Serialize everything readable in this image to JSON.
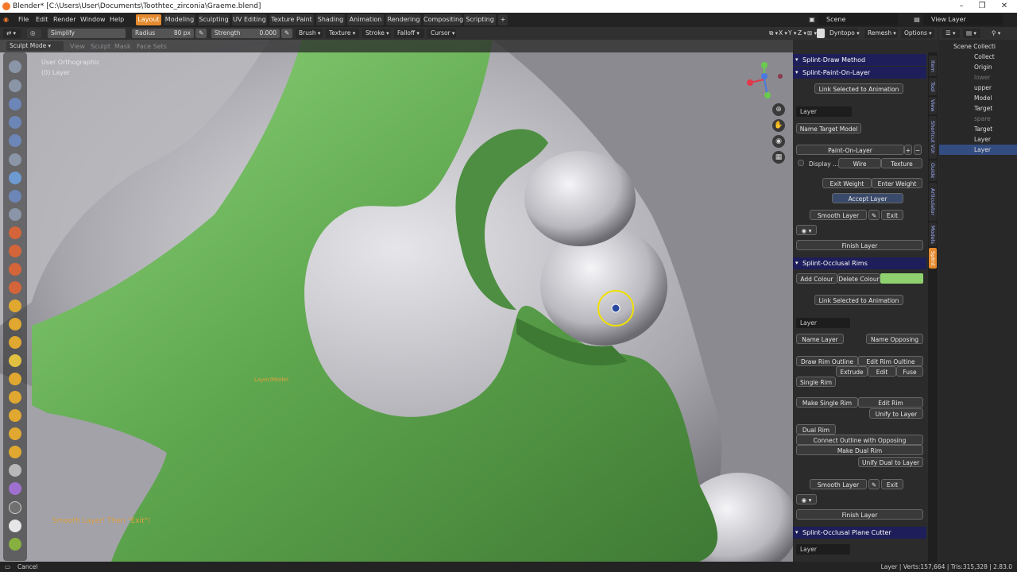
{
  "window": {
    "title": "Blender* [C:\\Users\\User\\Documents\\Toothtec_zirconia\\Graeme.blend]",
    "controls": [
      "–",
      "❐",
      "✕"
    ]
  },
  "menubar": {
    "menus": [
      "File",
      "Edit",
      "Render",
      "Window",
      "Help"
    ],
    "workspaces": [
      "Layout",
      "Modeling",
      "Sculpting",
      "UV Editing",
      "Texture Paint",
      "Shading",
      "Animation",
      "Rendering",
      "Compositing",
      "Scripting"
    ],
    "active_workspace": "Layout",
    "scene": "Scene",
    "view_layer": "View Layer"
  },
  "toolheader": {
    "brush_name": "Simplify",
    "radius_label": "Radius",
    "radius_value": "80 px",
    "strength_label": "Strength",
    "strength_value": "0.000",
    "dropdowns": [
      "Brush",
      "Texture",
      "Stroke",
      "Falloff",
      "Cursor"
    ],
    "axes": [
      "X",
      "Y",
      "Z"
    ],
    "dyntopo": "Dyntopo",
    "remesh": "Remesh",
    "options": "Options"
  },
  "viewport": {
    "mode": "Sculpt Mode",
    "menus": [
      "View",
      "Sculpt",
      "Mask",
      "Face Sets"
    ],
    "view_name": "User Orthographic",
    "layer_info": "(0) Layer",
    "object_label": "Layer/Model",
    "hint_text": "Smooth Layer! Then \"Exit\"!"
  },
  "npanel": {
    "draw_method": "Splint-Draw Method",
    "paint_on_layer": {
      "title": "Splint-Paint-On-Layer",
      "link_button": "Link Selected to Animation",
      "layer_field": "Layer",
      "name_target": "Name Target Model",
      "paint_on_layer": "Paint-On-Layer",
      "display_label": "Display ...",
      "wire": "Wire",
      "texture": "Texture",
      "exit_weight": "Exit Weight",
      "enter_weight": "Enter Weight",
      "accept_layer": "Accept Layer",
      "smooth_layer": "Smooth Layer",
      "exit": "Exit",
      "finish_layer": "Finish Layer"
    },
    "occlusal_rims": {
      "title": "Splint-Occlusal Rims",
      "add_colour": "Add Colour",
      "delete_colour": "Delete Colour",
      "swatch_color": "#8ed16e",
      "link_button": "Link Selected to Animation",
      "layer_field": "Layer",
      "name_layer": "Name Layer",
      "name_opposing": "Name Opposing",
      "draw_rim_outline": "Draw Rim Outline",
      "edit_rim_outline": "Edit Rim Oultine",
      "extrude": "Extrude",
      "edit": "Edit",
      "fuse": "Fuse",
      "single_rim": "Single Rim",
      "make_single_rim": "Make Single Rim",
      "edit_rim": "Edit Rim",
      "unify_to_layer": "Unify to Layer",
      "dual_rim": "Dual Rim",
      "connect_outline": "Connect Outline with Opposing",
      "make_dual_rim": "Make Dual Rim",
      "unify_dual": "Unify Dual to Layer",
      "smooth_layer": "Smooth Layer",
      "exit": "Exit",
      "finish_layer": "Finish Layer"
    },
    "plane_cutter": {
      "title": "Splint-Occlusal Plane Cutter",
      "layer_field": "Layer"
    },
    "tabs": [
      "Item",
      "Tool",
      "View",
      "Shortcut VUr",
      "Guide",
      "Articulator",
      "Models",
      "Splint"
    ],
    "active_tab": "Splint"
  },
  "outliner": {
    "rows": [
      {
        "label": "Scene Collecti",
        "dim": false
      },
      {
        "label": "Collect",
        "dim": false
      },
      {
        "label": "Origin",
        "dim": false
      },
      {
        "label": "lower",
        "dim": true
      },
      {
        "label": "upper",
        "dim": false
      },
      {
        "label": "Model",
        "dim": false
      },
      {
        "label": "Target",
        "dim": false
      },
      {
        "label": "spare",
        "dim": true
      },
      {
        "label": "Target",
        "dim": false
      },
      {
        "label": "Layer",
        "dim": false
      },
      {
        "label": "Layer",
        "dim": false
      }
    ]
  },
  "statusbar": {
    "left": "Cancel",
    "right": "Layer | Verts:157,664 | Tris:315,328 | 2.83.0"
  },
  "colors": {
    "accent": "#e58a2e",
    "model_green": "#6fb45e",
    "tooth_grey": "#c8c8cc",
    "panel_header": "#1e1e5a"
  }
}
